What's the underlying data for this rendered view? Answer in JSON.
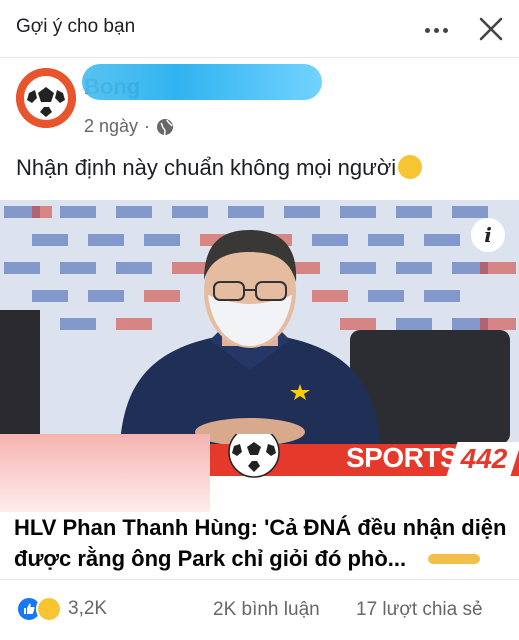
{
  "header": {
    "title": "Gợi ý cho bạn"
  },
  "post": {
    "page_name": "Bong",
    "time": "2 ngày",
    "separator": "·",
    "caption": "Nhận định này chuẩn không mọi người"
  },
  "link_preview": {
    "source_logo": "SPORTS",
    "source_logo_number": "442",
    "headline": "HLV Phan Thanh Hùng: 'Cả ĐNÁ đều nhận diện được rằng ông Park chỉ giỏi đó phò..."
  },
  "engagement": {
    "reaction_count": "3,2K",
    "comments": "2K bình luận",
    "shares": "17 lượt chia sẻ"
  },
  "icons": [
    "more-icon",
    "close-icon",
    "globe-icon",
    "info-icon",
    "like-reaction-icon",
    "haha-reaction-icon",
    "thinking-emoji-icon",
    "soccer-ball-icon"
  ],
  "colors": {
    "brand_red": "#e53a2b",
    "text_primary": "#1c1e21",
    "text_secondary": "#65676b",
    "like_blue": "#1877f2"
  }
}
